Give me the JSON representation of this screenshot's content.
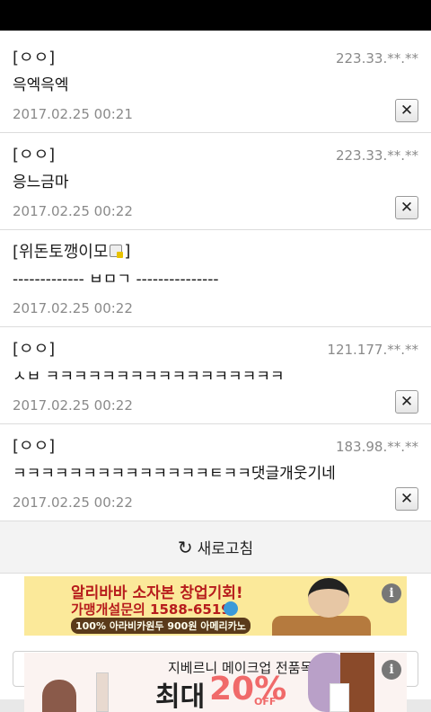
{
  "comments": [
    {
      "nick": "[ㅇㅇ]",
      "ip": "223.33.**.**",
      "body": "윽엑윽엑",
      "date": "2017.02.25 00:21",
      "has_delete": true
    },
    {
      "nick": "[ㅇㅇ]",
      "ip": "223.33.**.**",
      "body": "응느금마",
      "date": "2017.02.25 00:22",
      "has_delete": true
    },
    {
      "nick_prefix": "[위돈토깽이모",
      "nick_suffix": "]",
      "nick_icon": "fixed-nick-lock-icon",
      "ip": "",
      "body": "------------- ㅂㅁㄱ ---------------",
      "date": "2017.02.25 00:22",
      "has_delete": false
    },
    {
      "nick": "[ㅇㅇ]",
      "ip": "121.177.**.**",
      "body": "ㅅㅂ ㅋㅋㅋㅋㅋㅋㅋㅋㅋㅋㅋㅋㅋㅋㅋㅋㅋ",
      "date": "2017.02.25 00:22",
      "has_delete": true
    },
    {
      "nick": "[ㅇㅇ]",
      "ip": "183.98.**.**",
      "body": "ㅋㅋㅋㅋㅋㅋㅋㅋㅋㅋㅋㅋㅋㅋㅌㅋㅋ댓글개웃기네",
      "date": "2017.02.25 00:22",
      "has_delete": true
    }
  ],
  "delete_glyph": "✕",
  "refresh": {
    "icon": "refresh-icon",
    "label": "새로고침"
  },
  "ad1": {
    "line1": "알리바바 소자본 창업기회!",
    "line2": "가맹개설문의 1588-6519",
    "line3": "100% 아라비카원두 900원 아메리카노",
    "info": "i"
  },
  "ad2": {
    "line1": "지베르니 메이크업 전품목",
    "big": "최대",
    "percent": "20%",
    "off": "OFF",
    "info": "i"
  },
  "colors": {
    "ad1_bg": "#fbe99a",
    "ad1_text": "#b71c1c",
    "ad2_accent": "#f06a6a"
  }
}
